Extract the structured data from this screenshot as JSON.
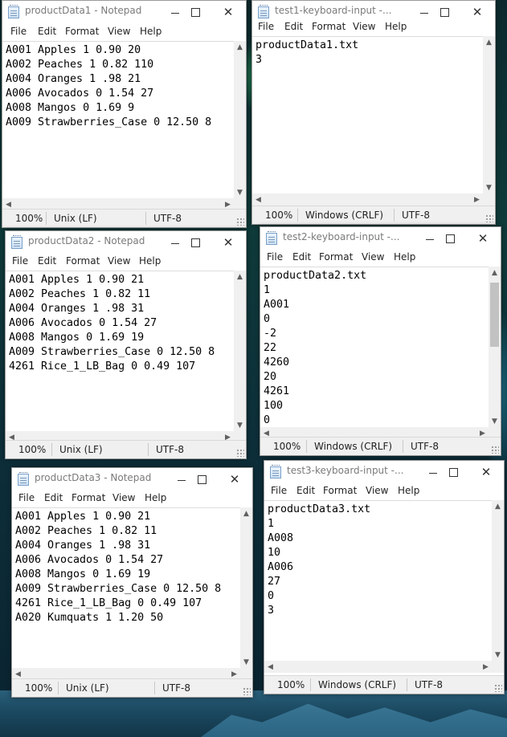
{
  "windows": [
    {
      "id": "w1",
      "title": "productData1 - Notepad",
      "menu": [
        "File",
        "Edit",
        "Format",
        "View",
        "Help"
      ],
      "lines": [
        "A001 Apples 1 0.90 20",
        "A002 Peaches 1 0.82 110",
        "A004 Oranges 1 .98 21",
        "A006 Avocados 0 1.54 27",
        "A008 Mangos 0 1.69 9",
        "A009 Strawberries_Case 0 12.50 8"
      ],
      "status": {
        "zoom": "100%",
        "eol": "Unix (LF)",
        "encoding": "UTF-8"
      }
    },
    {
      "id": "w2",
      "title": "test1-keyboard-input -...",
      "menu": [
        "File",
        "Edit",
        "Format",
        "View",
        "Help"
      ],
      "lines": [
        "productData1.txt",
        "3"
      ],
      "status": {
        "zoom": "100%",
        "eol": "Windows (CRLF)",
        "encoding": "UTF-8"
      }
    },
    {
      "id": "w3",
      "title": "productData2 - Notepad",
      "menu": [
        "File",
        "Edit",
        "Format",
        "View",
        "Help"
      ],
      "lines": [
        "A001 Apples 1 0.90 21",
        "A002 Peaches 1 0.82 11",
        "A004 Oranges 1 .98 31",
        "A006 Avocados 0 1.54 27",
        "A008 Mangos 0 1.69 19",
        "A009 Strawberries_Case 0 12.50 8",
        "4261 Rice_1_LB_Bag 0 0.49 107"
      ],
      "status": {
        "zoom": "100%",
        "eol": "Unix (LF)",
        "encoding": "UTF-8"
      }
    },
    {
      "id": "w4",
      "title": "test2-keyboard-input -...",
      "menu": [
        "File",
        "Edit",
        "Format",
        "View",
        "Help"
      ],
      "lines": [
        "productData2.txt",
        "1",
        "A001",
        "0",
        "-2",
        "22",
        "4260",
        "20",
        "4261",
        "100",
        "0"
      ],
      "status": {
        "zoom": "100%",
        "eol": "Windows (CRLF)",
        "encoding": "UTF-8"
      }
    },
    {
      "id": "w5",
      "title": "productData3 - Notepad",
      "menu": [
        "File",
        "Edit",
        "Format",
        "View",
        "Help"
      ],
      "lines": [
        "A001 Apples 1 0.90 21",
        "A002 Peaches 1 0.82 11",
        "A004 Oranges 1 .98 31",
        "A006 Avocados 0 1.54 27",
        "A008 Mangos 0 1.69 19",
        "A009 Strawberries_Case 0 12.50 8",
        "4261 Rice_1_LB_Bag 0 0.49 107",
        "A020 Kumquats 1 1.20 50"
      ],
      "status": {
        "zoom": "100%",
        "eol": "Unix (LF)",
        "encoding": "UTF-8"
      }
    },
    {
      "id": "w6",
      "title": "test3-keyboard-input -...",
      "menu": [
        "File",
        "Edit",
        "Format",
        "View",
        "Help"
      ],
      "lines": [
        "productData3.txt",
        "1",
        "A008",
        "10",
        "A006",
        "27",
        "0",
        "3"
      ],
      "status": {
        "zoom": "100%",
        "eol": "Windows (CRLF)",
        "encoding": "UTF-8"
      }
    }
  ],
  "icons": {
    "app": "notepad-icon",
    "minimize": "minimize-icon",
    "maximize": "maximize-icon",
    "close": "close-icon"
  }
}
